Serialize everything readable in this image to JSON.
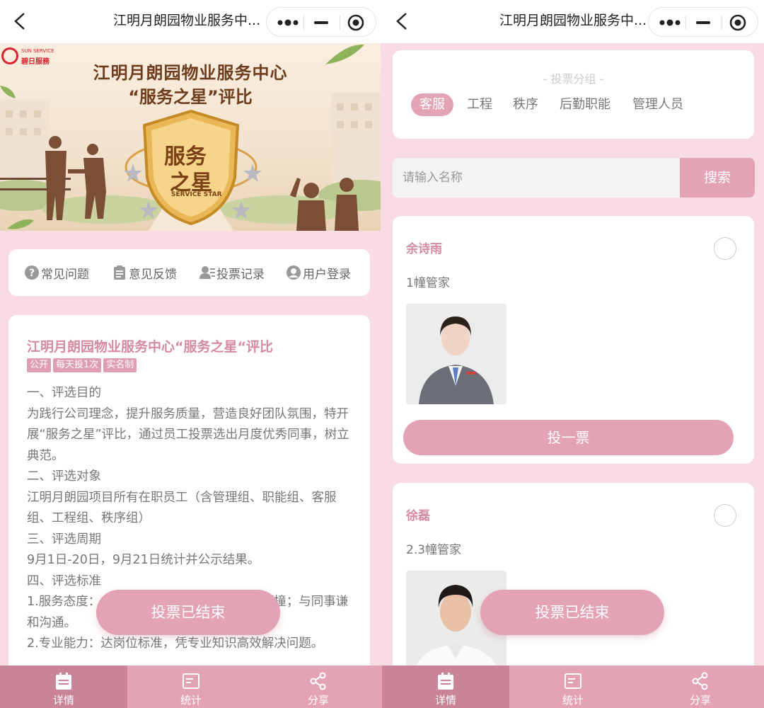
{
  "left": {
    "nav": {
      "title": "江明月朗园物业服务中..."
    },
    "banner": {
      "logo_en": "SUN SERVICE",
      "logo_cn": "碧日服務",
      "title_line1": "江明月朗园物业服务中心",
      "title_line2": "“服务之星”评比",
      "shield_line1": "服务",
      "shield_line2": "之星",
      "shield_line3": "SERVICE STAR"
    },
    "menu": [
      {
        "label": "常见问题",
        "icon": "question-circle-icon"
      },
      {
        "label": "意见反馈",
        "icon": "clipboard-icon"
      },
      {
        "label": "投票记录",
        "icon": "user-list-icon"
      },
      {
        "label": "用户登录",
        "icon": "user-circle-icon"
      }
    ],
    "intro": {
      "title": "江明月朗园物业服务中心“服务之星“评比",
      "tags": [
        "公开",
        "每天投1次",
        "实名制"
      ],
      "lines": [
        "一、评选目的",
        "为践行公司理念，提升服务质量，营造良好团队氛围，特开展“服务之星”评比，通过员工投票选出月度优秀同事，树立典范。",
        "二、评选对象",
        "江明月朗园项目所有在职员工（含管理组、职能组、客服组、工程组、秩序组）",
        "三、评选周期",
        "9月1日-20日，9月21日统计并公示结果。",
        "四、评选标准",
        "1.服务态度：主动热情，耐心细致，不推诿顶撞；与同事谦和沟通。",
        "2.专业能力：达岗位标准，凭专业知识高效解决问题。"
      ]
    },
    "ended_label": "投票已结束"
  },
  "right": {
    "nav": {
      "title": "江明月朗园物业服务中..."
    },
    "group_label": "- 投票分组 -",
    "groups": [
      "客服",
      "工程",
      "秩序",
      "后勤职能",
      "管理人员"
    ],
    "active_group": "客服",
    "search": {
      "placeholder": "请输入名称",
      "button": "搜索"
    },
    "candidates": [
      {
        "name": "余诗雨",
        "role": "1幢管家",
        "vote_label": "投一票"
      },
      {
        "name": "徐磊",
        "role": "2.3幢管家"
      }
    ],
    "ended_label": "投票已结束"
  },
  "tabbar": [
    {
      "label": "详情",
      "icon": "calendar-icon",
      "active": true
    },
    {
      "label": "统计",
      "icon": "chart-card-icon",
      "active": false
    },
    {
      "label": "分享",
      "icon": "share-icon",
      "active": false
    }
  ],
  "colors": {
    "accent": "#e3a3b5",
    "accent_dark": "#c98497",
    "title_pink": "#d58aa0",
    "background": "#f9dbe4"
  }
}
